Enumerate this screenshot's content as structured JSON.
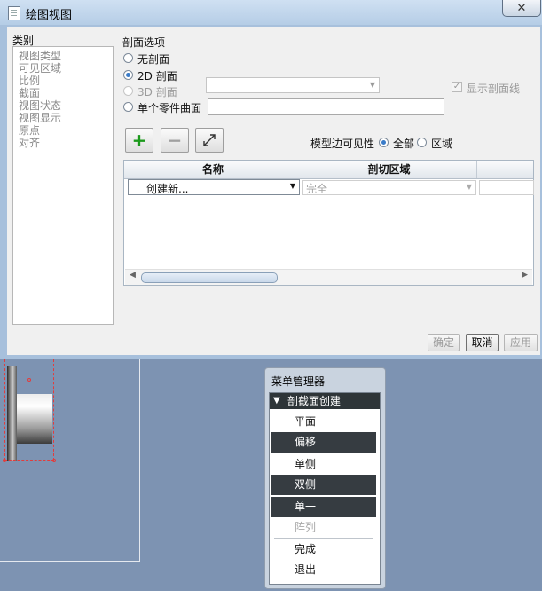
{
  "window": {
    "title": "绘图视图",
    "close_glyph": "✕"
  },
  "categories": {
    "label": "类别",
    "items": [
      "视图类型",
      "可见区域",
      "比例",
      "截面",
      "视图状态",
      "视图显示",
      "原点",
      "对齐"
    ]
  },
  "section_options": {
    "label": "剖面选项",
    "none": "无剖面",
    "two_d": "2D 剖面",
    "three_d": "3D 剖面",
    "single_part_surface": "单个零件曲面",
    "show_section_lines": "显示剖面线",
    "selected": "2D 剖面"
  },
  "visibility": {
    "label": "模型边可见性",
    "all": "全部",
    "area": "区域",
    "selected": "全部"
  },
  "toolbar": {
    "add": "+",
    "remove": "−"
  },
  "table": {
    "columns": [
      "名称",
      "剖切区域"
    ],
    "row": {
      "name": "创建新...",
      "area": "完全"
    }
  },
  "buttons": {
    "ok": "确定",
    "cancel": "取消",
    "apply": "应用"
  },
  "menu_manager": {
    "title": "菜单管理器",
    "header": "剖截面创建",
    "items": [
      {
        "label": "平面",
        "state": "normal"
      },
      {
        "label": "偏移",
        "state": "dark"
      },
      {
        "label": "单侧",
        "state": "normal"
      },
      {
        "label": "双侧",
        "state": "dark"
      },
      {
        "label": "单一",
        "state": "dark"
      },
      {
        "label": "阵列",
        "state": "disabled"
      },
      {
        "label": "完成",
        "state": "normal"
      },
      {
        "label": "退出",
        "state": "normal"
      }
    ]
  },
  "colors": {
    "accent": "#3a7bc8",
    "menu_dark": "#363c41",
    "canvas": "#7d93b2",
    "highlight": "#e23c3c"
  }
}
